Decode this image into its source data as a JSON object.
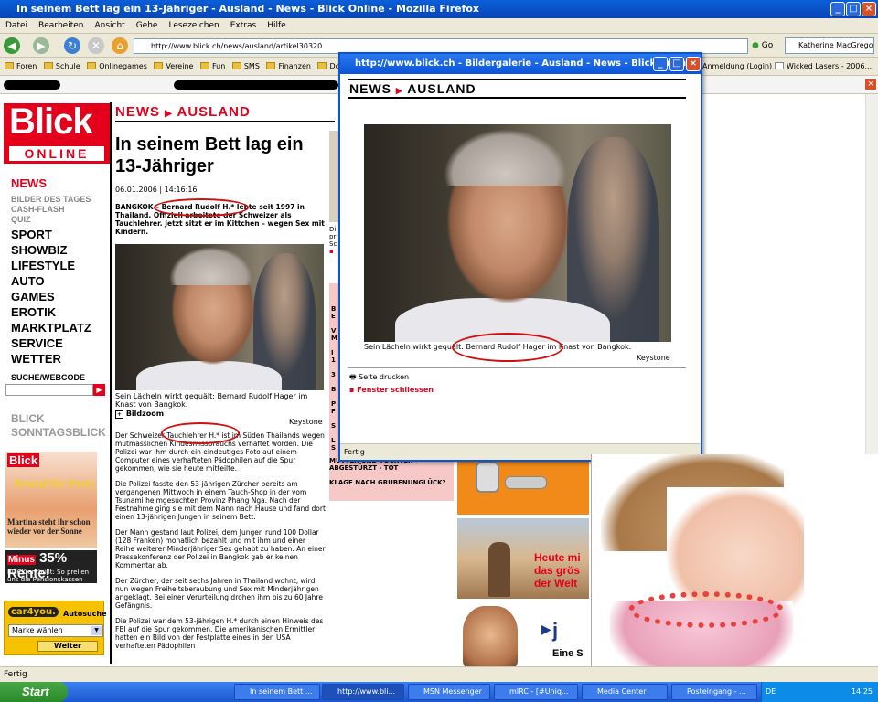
{
  "window": {
    "title": "In seinem Bett lag ein 13-Jähriger - Ausland - News - Blick Online - Mozilla Firefox"
  },
  "menu": [
    "Datei",
    "Bearbeiten",
    "Ansicht",
    "Gehe",
    "Lesezeichen",
    "Extras",
    "Hilfe"
  ],
  "nav": {
    "url": "http://www.blick.ch/news/ausland/artikel30320",
    "go": "Go",
    "search_value": "Katherine MacGregor"
  },
  "bookmarks": [
    "Foren",
    "Schule",
    "Onlinegames",
    "Vereine",
    "Fun",
    "SMS",
    "Finanzen",
    "Downloa",
    "Anmeldung (Login)",
    "Wicked Lasers - 2006..."
  ],
  "status": "Fertig",
  "logo": {
    "top": "Blick",
    "bottom": "ONLINE"
  },
  "leftnav": {
    "news": "NEWS",
    "sub": [
      "BILDER DES TAGES",
      "CASH-FLASH",
      "QUIZ"
    ],
    "main": [
      "SPORT",
      "SHOWBIZ",
      "LIFESTYLE",
      "AUTO",
      "GAMES",
      "EROTIK",
      "MARKTPLATZ",
      "SERVICE",
      "WETTER"
    ],
    "websearch": "SUCHE/WEBCODE",
    "sonntag": [
      "BLICK",
      "SONNTAGSBLICK"
    ]
  },
  "promo1": {
    "logo": "Blick",
    "headline": "Brutal für Patty",
    "sub": "Martina steht ihr schon wieder vor der Sonne"
  },
  "promo2": {
    "big": "35% Rente!",
    "tag": "Minus",
    "sub": "BLICK enthüllt: So prellen uns die Pensionskassen"
  },
  "car4you": {
    "logo": "car4you.",
    "label": "Autosuche",
    "select": "Marke wählen",
    "button": "Weiter"
  },
  "article": {
    "breadcrumb": [
      "NEWS",
      "AUSLAND"
    ],
    "title": "In seinem Bett lag ein 13-Jähriger",
    "date": "06.01.2006 | 14:16:16",
    "lead": "BANGKOK – Bernard Rudolf H.* lebte seit 1997 in Thailand. Offiziell arbeitete der Schweizer als Tauchlehrer. Jetzt sitzt er im Kittchen – wegen Sex mit Kindern.",
    "caption": "Sein Lächeln wirkt gequält: Bernard Rudolf Hager im Knast von Bangkok.",
    "bildzoom": "Bildzoom",
    "credit": "Keystone",
    "paragraphs": [
      "Der Schweizer Tauchlehrer H.* ist im Süden Thailands wegen mutmasslichen Kindesmissbrauchs verhaftet worden. Die Polizei war ihm durch ein eindeutiges Foto auf einem Computer eines verhafteten Pädophilen auf die Spur gekommen, wie sie heute mitteilte.",
      "Die Polizei fasste den 53-jährigen Zürcher bereits am vergangenen Mittwoch in einem Tauch-Shop in der vom Tsunami heimgesuchten Provinz Phang Nga. Nach der Festnahme ging sie mit dem Mann nach Hause und fand dort einen 13-jährigen Jungen in seinem Bett.",
      "Der Mann gestand laut Polizei, dem Jungen rund 100 Dollar (128 Franken) monatlich bezahlt und mit ihm und einer Reihe weiterer Minderjähriger Sex gehabt zu haben. An einer Pressekonferenz der Polizei in Bangkok gab er keinen Kommentar ab.",
      "Der Zürcher, der seit sechs Jahren in Thailand wohnt, wird nun wegen Freiheitsberaubung und Sex mit Minderjährigen angeklagt. Bei einer Verurteilung drohen ihm bis zu 60 Jahre Gefängnis.",
      "Die Polizei war dem 53-jährigen H.* durch einen Hinweis des FBI auf die Spur gekommen. Die amerikanischen Ermittler hatten ein Bild von der Festplatte eines in den USA verhafteten Pädophilen"
    ]
  },
  "middle": {
    "pink": [
      "B",
      "E",
      "V",
      "M",
      "I",
      "1",
      "3",
      "B",
      "P",
      "F",
      "S",
      "L",
      "S"
    ],
    "klage": [
      "MUTTER UND TOCHTER ABGESTÜRZT - TOT",
      "KLAGE NACH GRUBENUNGLÜCK?"
    ],
    "strip": [
      "Di",
      "pr",
      "Sc"
    ]
  },
  "ads": {
    "heute": "Heute mi das grös der Welt",
    "j": "j",
    "es": "Eine S"
  },
  "popup": {
    "title": "http://www.blick.ch - Bildergalerie - Ausland - News - Blick Online...",
    "breadcrumb": [
      "NEWS",
      "AUSLAND"
    ],
    "caption": "Sein Lächeln wirkt gequält: Bernard Rudolf Hager im Knast von Bangkok.",
    "credit": "Keystone",
    "print": "Seite drucken",
    "close": "Fenster schliessen",
    "status": "Fertig"
  },
  "taskbar": {
    "start": "Start",
    "tasks": [
      "In seinem Bett ...",
      "http://www.bli...",
      "MSN Messenger",
      "mIRC - [#Uniq...",
      "Media Center",
      "Posteingang - ..."
    ],
    "lang": "DE",
    "clock": "14:25"
  }
}
